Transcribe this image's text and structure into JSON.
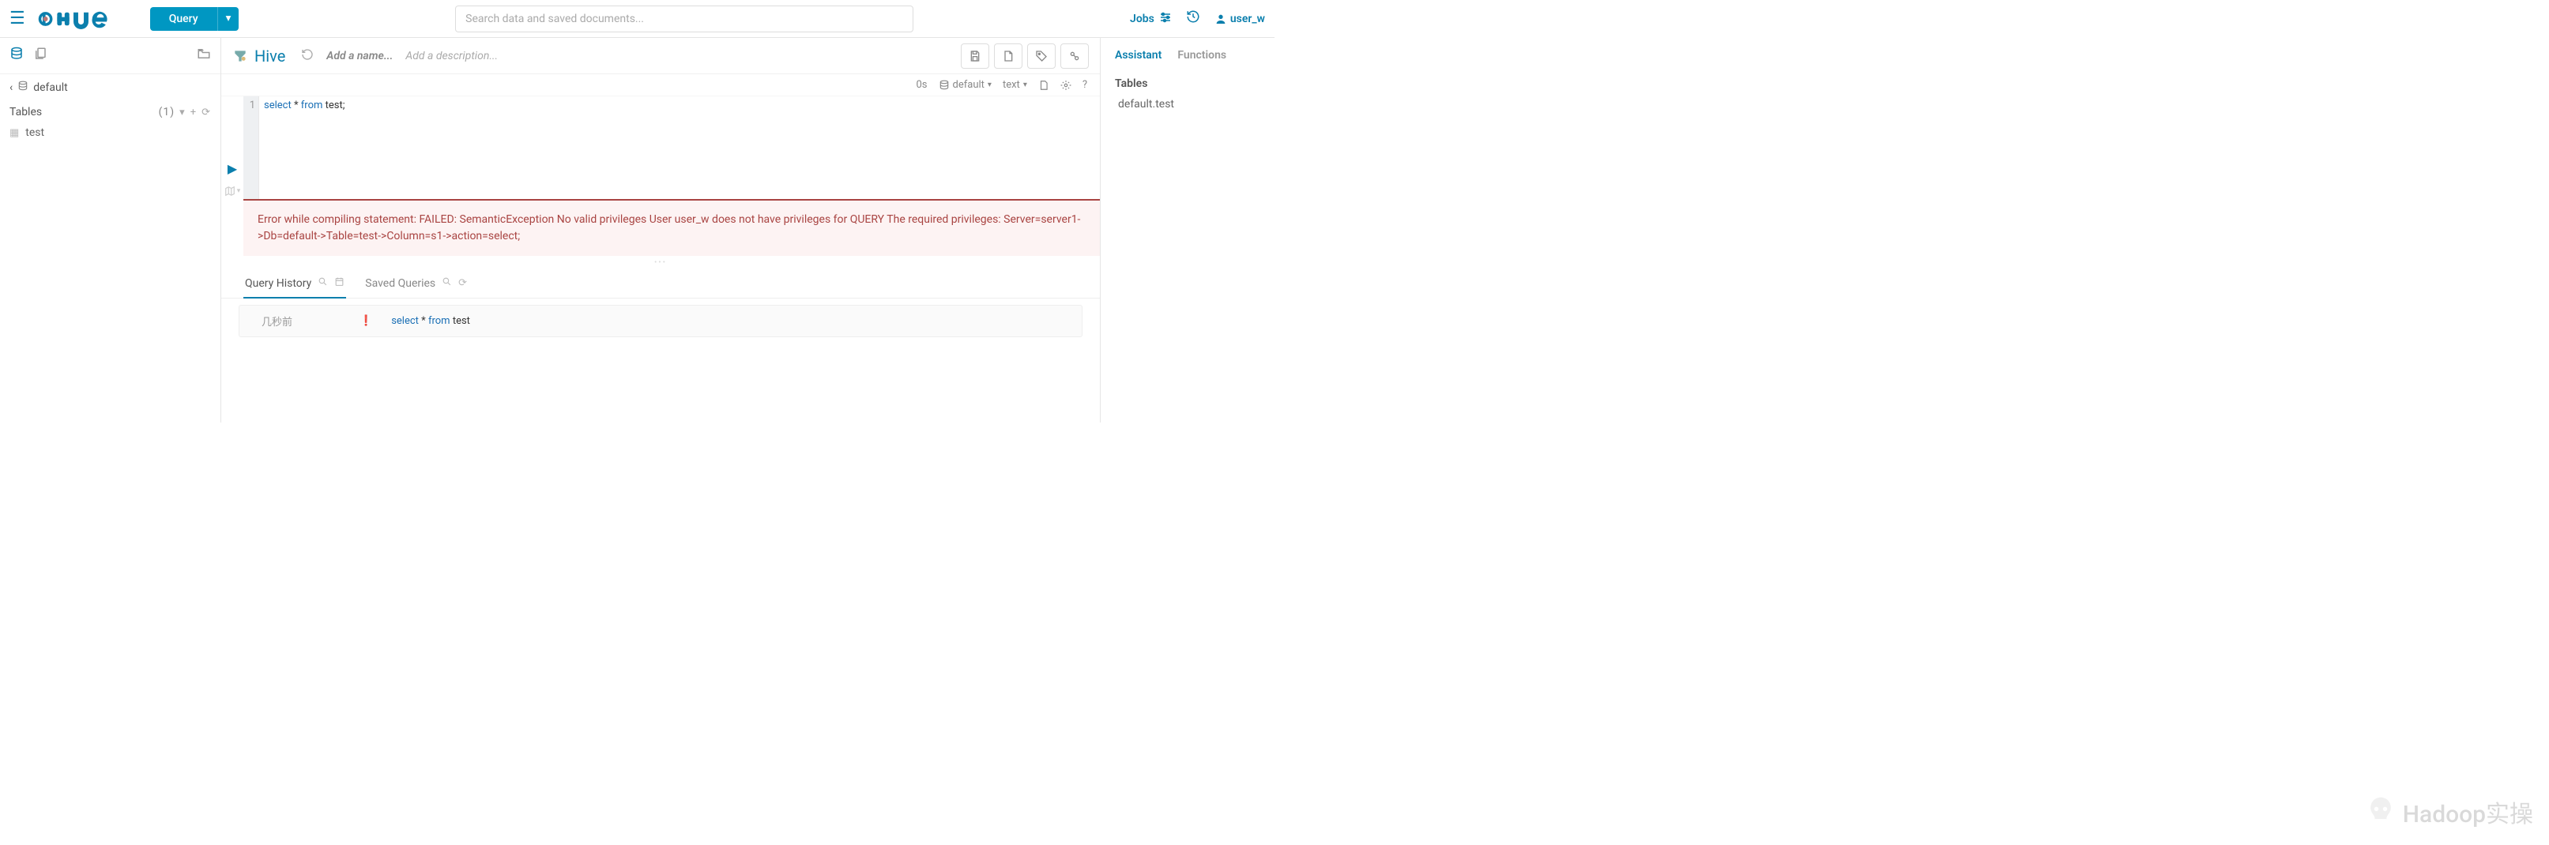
{
  "top": {
    "query_label": "Query",
    "search_placeholder": "Search data and saved documents...",
    "jobs_label": "Jobs",
    "user_label": "user_w"
  },
  "left": {
    "breadcrumb_db": "default",
    "tables_label": "Tables",
    "tables_count": "(1)",
    "tables": [
      {
        "name": "test"
      }
    ]
  },
  "editor": {
    "engine_label": "Hive",
    "name_placeholder": "Add a name...",
    "desc_placeholder": "Add a description...",
    "elapsed": "0s",
    "db_label": "default",
    "format_label": "text",
    "gutter_line": "1",
    "tok_select": "select",
    "tok_star": " * ",
    "tok_from": "from",
    "tok_space": " ",
    "tok_table": "test",
    "tok_semi": ";",
    "error_text": "Error while compiling statement: FAILED: SemanticException No valid privileges User user_w does not have privileges for QUERY The required privileges: Server=server1->Db=default->Table=test->Column=s1->action=select;"
  },
  "tabs": {
    "history_label": "Query History",
    "saved_label": "Saved Queries"
  },
  "history": {
    "time": "几秒前",
    "sql_select": "select",
    "sql_star": " * ",
    "sql_from": "from",
    "sql_space": " ",
    "sql_table": "test"
  },
  "right": {
    "assistant_label": "Assistant",
    "functions_label": "Functions",
    "tables_heading": "Tables",
    "items": [
      {
        "name": "default.test"
      }
    ]
  },
  "watermark": "Hadoop实操"
}
